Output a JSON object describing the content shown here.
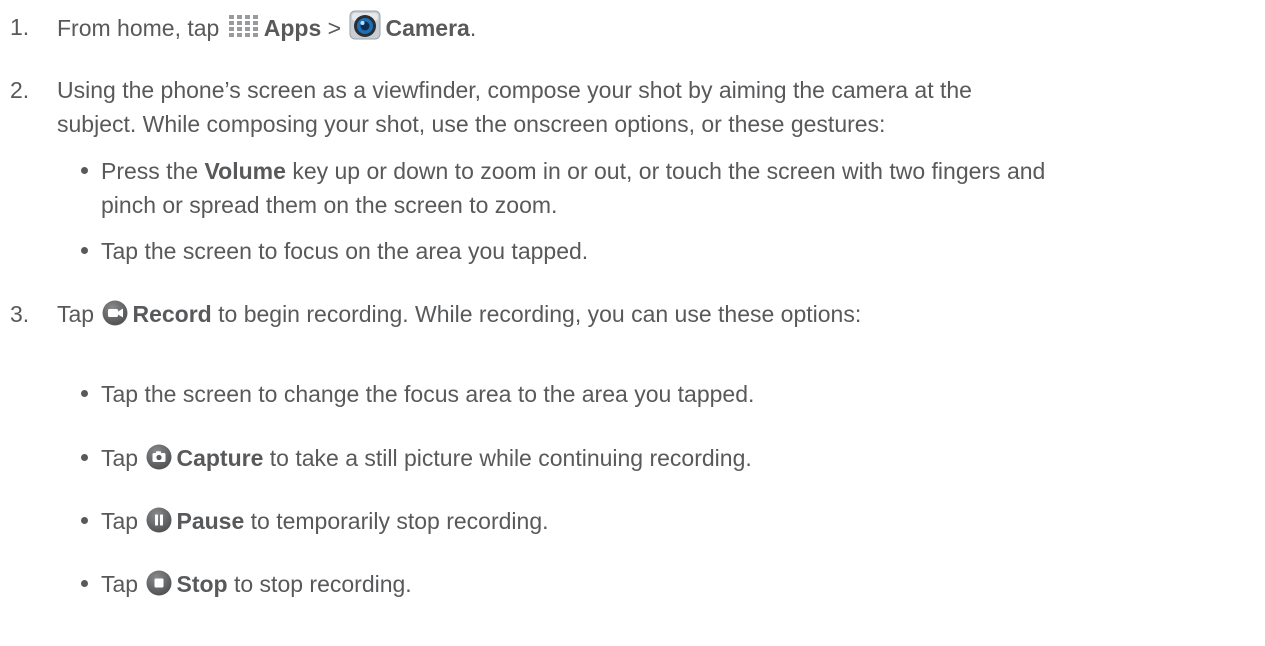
{
  "steps": [
    {
      "number": "1.",
      "lead": "From home, tap",
      "apps_label": "Apps",
      "sep": ">",
      "camera_label": "Camera",
      "tail": "."
    },
    {
      "number": "2.",
      "line1": "Using the phone’s screen as a viewfinder, compose your shot by aiming the camera at the",
      "line2": "subject. While composing your shot, use the onscreen options, or these gestures:",
      "bullets": [
        {
          "lead": "Press the",
          "bold": "Volume",
          "line1_rest": "key up or down to zoom in or out, or touch the screen with two fingers and",
          "line2": "pinch or spread them on the screen to zoom."
        },
        {
          "text": "Tap the screen to focus on the area you tapped."
        }
      ]
    },
    {
      "number": "3.",
      "lead": "Tap",
      "bold": "Record",
      "rest": "to begin recording. While recording, you can use these options:",
      "bullets": [
        {
          "text": "Tap the screen to change the focus area to the area you tapped."
        },
        {
          "lead": "Tap",
          "bold": "Capture",
          "rest": "to take a still picture while continuing recording."
        },
        {
          "lead": "Tap",
          "bold": "Pause",
          "rest": "to temporarily stop recording."
        },
        {
          "lead": "Tap",
          "bold": "Stop",
          "rest": "to stop recording."
        }
      ]
    }
  ],
  "icons": {
    "apps": "apps-grid-icon",
    "camera": "camera-app-icon",
    "record": "record-video-icon",
    "capture": "capture-photo-icon",
    "pause": "pause-icon",
    "stop": "stop-icon"
  },
  "colors": {
    "text": "#58595b",
    "icon_button": "#6d6e70",
    "apps_grid": "#9a9b9c",
    "camera_blue": "#1f6fb6"
  }
}
